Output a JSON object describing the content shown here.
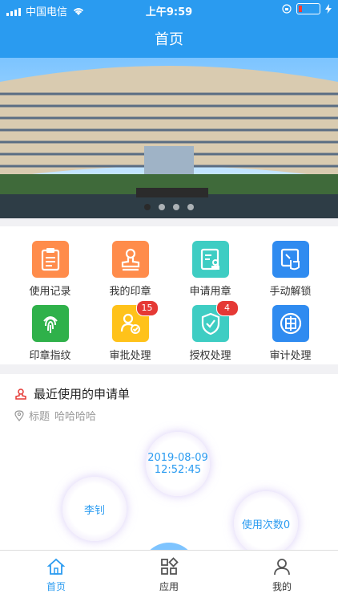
{
  "status_bar": {
    "carrier": "中国电信",
    "time": "上午9:59",
    "battery_level_percent": 15,
    "icons": [
      "signal-icon",
      "wifi-icon",
      "orientation-lock-icon",
      "battery-icon",
      "charging-icon"
    ]
  },
  "nav": {
    "title": "首页"
  },
  "banner": {
    "image": "building-photo",
    "slides_total": 4,
    "active_slide": 1
  },
  "grid": {
    "items": [
      {
        "label": "使用记录",
        "icon": "clipboard-icon",
        "color": "#ff8c4b"
      },
      {
        "label": "我的印章",
        "icon": "stamp-icon",
        "color": "#ff8c4b"
      },
      {
        "label": "申请用章",
        "icon": "document-form-icon",
        "color": "#3ecdc3"
      },
      {
        "label": "手动解锁",
        "icon": "hand-unlock-icon",
        "color": "#2f8bf0"
      },
      {
        "label": "印章指纹",
        "icon": "fingerprint-icon",
        "color": "#2fb14a"
      },
      {
        "label": "审批处理",
        "icon": "user-check-icon",
        "color": "#ffc21a",
        "badge": "15"
      },
      {
        "label": "授权处理",
        "icon": "shield-check-icon",
        "color": "#3ecdc3",
        "badge": "4"
      },
      {
        "label": "审计处理",
        "icon": "audit-seal-icon",
        "color": "#2f8bf0"
      }
    ]
  },
  "recent": {
    "title": "最近使用的申请单",
    "subtitle_label": "标题",
    "subtitle_value": "哈哈哈哈",
    "bubble_date": "2019-08-09",
    "bubble_time": "12:52:45",
    "bubble_name": "李钊",
    "bubble_count": "使用次数0"
  },
  "tabbar": {
    "tabs": [
      {
        "label": "首页",
        "icon": "home-icon",
        "active": true
      },
      {
        "label": "应用",
        "icon": "apps-icon",
        "active": false
      },
      {
        "label": "我的",
        "icon": "user-icon",
        "active": false
      }
    ]
  },
  "colors": {
    "primary": "#2a9bf0",
    "badge": "#e53935"
  }
}
